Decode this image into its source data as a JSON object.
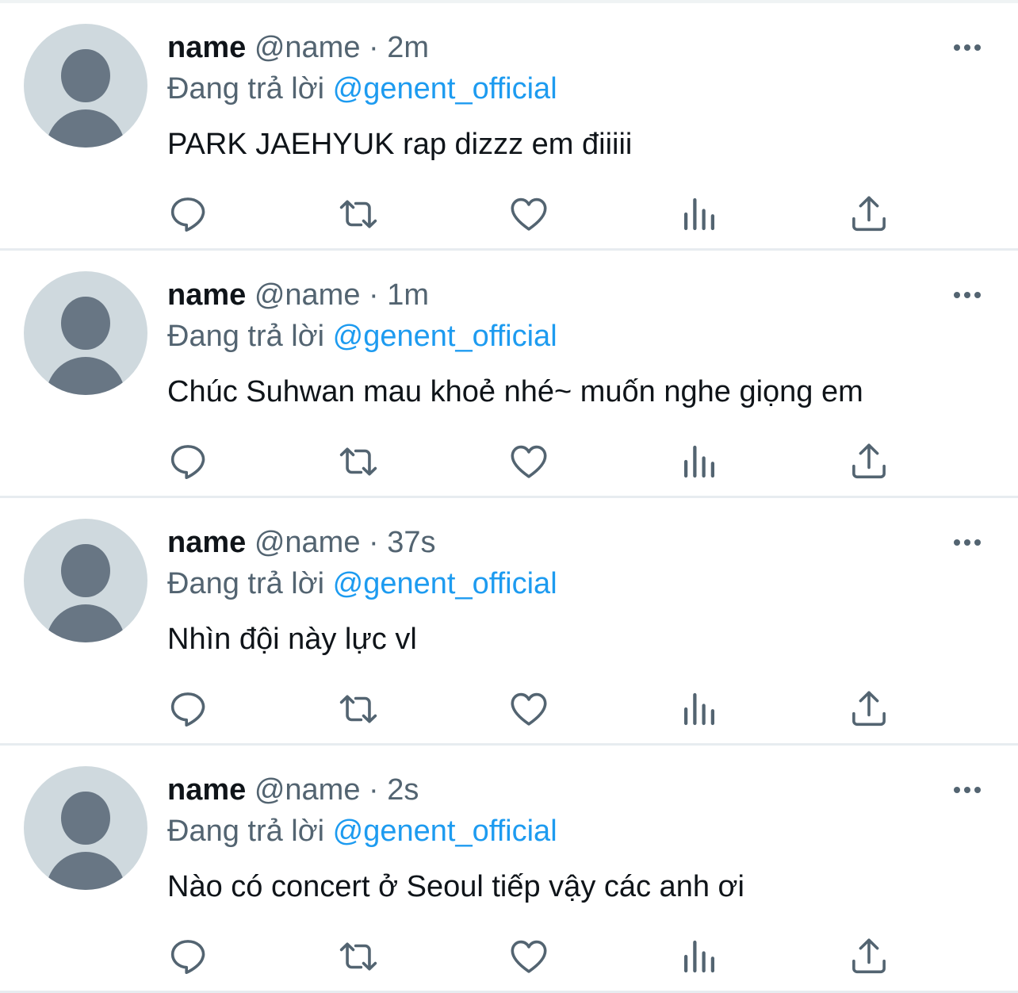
{
  "tweets": [
    {
      "display_name": "name",
      "handle": "@name",
      "time": "2m",
      "reply_prefix": "Đang trả lời",
      "reply_to": "@genent_official",
      "text": "PARK JAEHYUK rap dizzz em điiiii"
    },
    {
      "display_name": "name",
      "handle": "@name",
      "time": "1m",
      "reply_prefix": "Đang trả lời",
      "reply_to": "@genent_official",
      "text": "Chúc Suhwan mau khoẻ nhé~ muốn nghe giọng em"
    },
    {
      "display_name": "name",
      "handle": "@name",
      "time": "37s",
      "reply_prefix": "Đang trả lời",
      "reply_to": "@genent_official",
      "text": "Nhìn đội này lực vl"
    },
    {
      "display_name": "name",
      "handle": "@name",
      "time": "2s",
      "reply_prefix": "Đang trả lời",
      "reply_to": "@genent_official",
      "text": "Nào có concert ở Seoul tiếp vậy các anh ơi"
    }
  ],
  "separator": "·",
  "icons": {
    "more": "more-dots-icon",
    "reply": "reply-bubble-icon",
    "retweet": "retweet-icon",
    "like": "heart-icon",
    "views": "analytics-bars-icon",
    "share": "share-upload-icon"
  },
  "colors": {
    "text_primary": "#0f1419",
    "text_secondary": "#536471",
    "mention": "#1d9bf0",
    "avatar_bg": "#cfd9de",
    "avatar_figure": "#687684",
    "divider": "#e7ecf0"
  }
}
